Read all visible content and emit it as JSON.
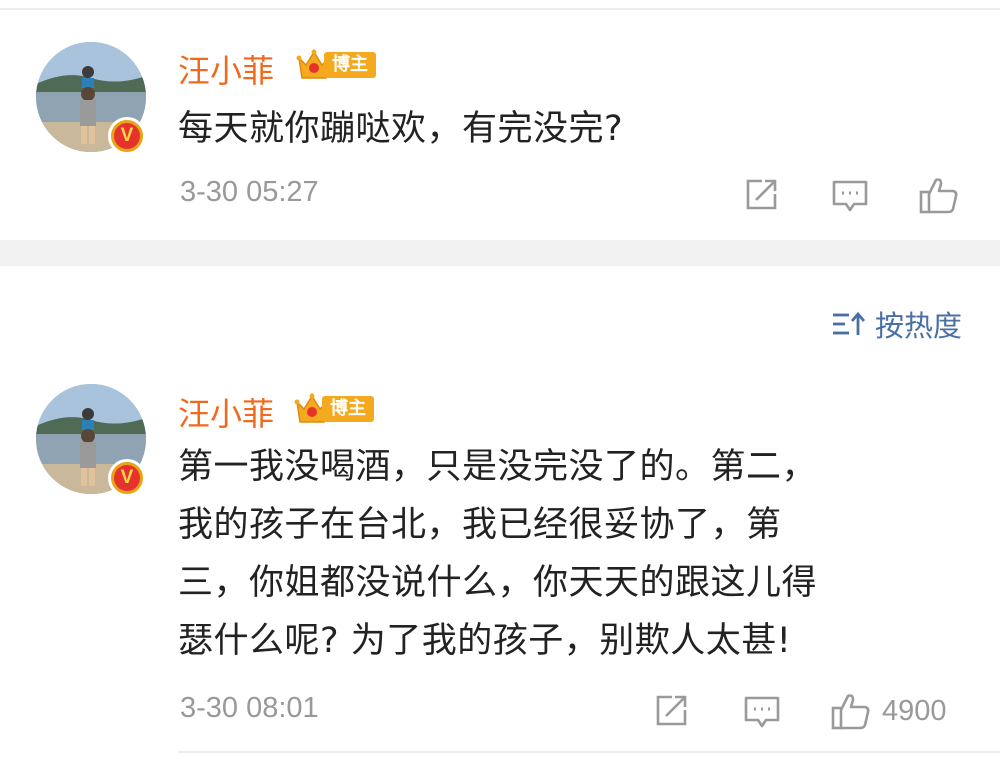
{
  "comments": [
    {
      "username": "汪小菲",
      "badge_label": "博主",
      "verified_mark": "V",
      "content_lines": [
        "每天就你蹦哒欢，有完没完?"
      ],
      "timestamp": "3-30 05:27",
      "like_count": ""
    },
    {
      "username": "汪小菲",
      "badge_label": "博主",
      "verified_mark": "V",
      "content_lines": [
        "第一我没喝酒，只是没完没了的。第二，",
        "我的孩子在台北，我已经很妥协了，第",
        "三，你姐都没说什么，你天天的跟这儿得",
        "瑟什么呢? 为了我的孩子，别欺人太甚!"
      ],
      "timestamp": "3-30 08:01",
      "like_count": "4900"
    }
  ],
  "sort": {
    "label": "按热度",
    "icon": "sort-icon"
  },
  "icons": {
    "share": "share-icon",
    "comment": "comment-icon",
    "like": "thumbs-up-icon",
    "crown": "crown-icon",
    "verified": "verified-v-icon"
  },
  "colors": {
    "username": "#f06a1e",
    "badge": "#f4a91e",
    "sort_link": "#4a6fa5",
    "meta_text": "#999999",
    "divider": "#f2f2f2"
  }
}
